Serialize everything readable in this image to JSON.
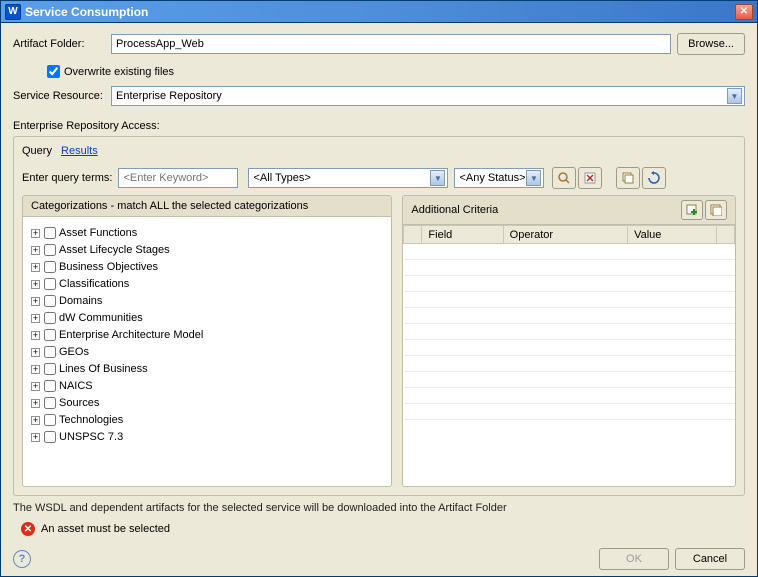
{
  "title": "Service Consumption",
  "app_icon_letter": "W",
  "labels": {
    "artifact_folder": "Artifact Folder:",
    "browse": "Browse...",
    "overwrite": "Overwrite existing files",
    "service_resource": "Service Resource:",
    "repo_access": "Enterprise Repository Access:",
    "query_tab": "Query",
    "results_tab": "Results",
    "enter_terms": "Enter query terms:",
    "categorizations": "Categorizations - match ALL the selected categorizations",
    "additional": "Additional Criteria",
    "info": "The WSDL and dependent artifacts for the selected service will be downloaded into the Artifact Folder",
    "error": "An asset must be selected",
    "ok": "OK",
    "cancel": "Cancel"
  },
  "values": {
    "artifact_folder": "ProcessApp_Web",
    "service_resource": "Enterprise Repository",
    "keyword_placeholder": "<Enter Keyword>",
    "types": "<All Types>",
    "status": "<Any Status>"
  },
  "columns": {
    "field": "Field",
    "operator": "Operator",
    "value": "Value"
  },
  "categories": [
    "Asset Functions",
    "Asset Lifecycle Stages",
    "Business Objectives",
    "Classifications",
    "Domains",
    "dW Communities",
    "Enterprise Architecture Model",
    "GEOs",
    "Lines Of Business",
    "NAICS",
    "Sources",
    "Technologies",
    "UNSPSC 7.3"
  ]
}
